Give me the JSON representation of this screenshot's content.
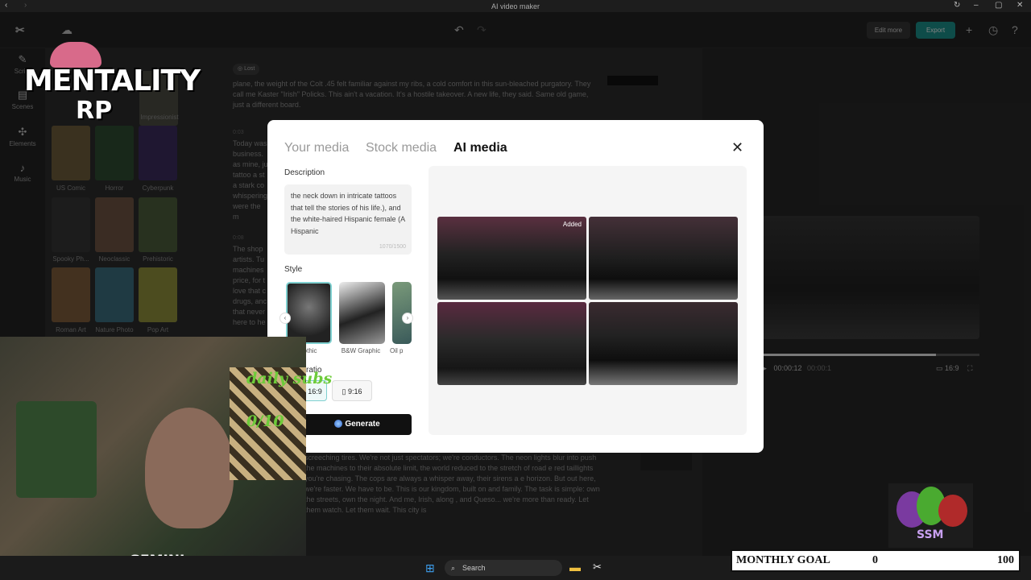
{
  "window": {
    "title": "AI video maker"
  },
  "header": {
    "edit_more": "Edit more",
    "export": "Export"
  },
  "rail": [
    {
      "label": "Script",
      "icon": "script-icon"
    },
    {
      "label": "Scenes",
      "icon": "scenes-icon"
    },
    {
      "label": "Elements",
      "icon": "elements-icon"
    },
    {
      "label": "Music",
      "icon": "music-icon"
    }
  ],
  "styles_panel": {
    "items": [
      "Impressionist",
      "US Comic",
      "Horror",
      "Cyberpunk",
      "Spooky Ph...",
      "Neoclassic",
      "Prehistoric",
      "Roman Art",
      "Nature Photo",
      "Pop Art"
    ]
  },
  "editor": {
    "lost_label": "Lost",
    "time1": "0:03",
    "time2": "0:08",
    "para0": "plane, the weight of the Colt .45 felt familiar against my ribs, a cold comfort in this sun-bleached purgatory. They call me Kaster \"Irish\" Policks. This ain't a vacation. It's a hostile takeover. A new life, they said. Same old game, just a different board.",
    "para1": "Today was business. as mine, ju tattoo a st a stark co whispering were the m",
    "para2": "The shop artists. Tu machines price, for t love that c drugs, anc that never here to he",
    "para3": "screeching tires. We're not just spectators; we're conductors. The neon lights blur into push the machines to their absolute limit, the world reduced to the stretch of road e red taillights you're chasing. The cops are always a whisper away, their sirens a e horizon. But out here, we're faster. We have to be. This is our kingdom, built on and family. The task is simple: own the streets, own the night. And me, Irish, along , and Queso... we're more than ready. Let them watch. Let them wait. This city is"
  },
  "player": {
    "time": "00:00:12",
    "duration": "00:00:1",
    "ratio": "16:9"
  },
  "modal": {
    "tabs": [
      "Your media",
      "Stock media",
      "AI media"
    ],
    "active_tab": "AI media",
    "description_label": "Description",
    "description_text": "the neck down in intricate tattoos that tell the stories of his life.), and the white-haired Hispanic female (A Hispanic",
    "char_count": "1070/1500",
    "style_label": "Style",
    "styles": [
      "Gothic",
      "B&W Graphic",
      "Oil p"
    ],
    "ratio_label": "ratio",
    "ratios": [
      "16:9",
      "9:16"
    ],
    "generate_label": "Generate",
    "added_badge": "Added"
  },
  "stream_overlay": {
    "logo_text": "MENTALITY",
    "logo_sub": "RP",
    "daily_subs_label": "daily subs",
    "daily_subs_value": "0/10",
    "gemini": "GEMINI",
    "ssm": "SSM"
  },
  "goal": {
    "label": "MONTHLY GOAL",
    "current": "0",
    "target": "100"
  },
  "taskbar": {
    "search": "Search"
  },
  "colors": {
    "accent": "#1a8a85",
    "modal_bg": "#ffffff",
    "generate_bg": "#111111"
  }
}
